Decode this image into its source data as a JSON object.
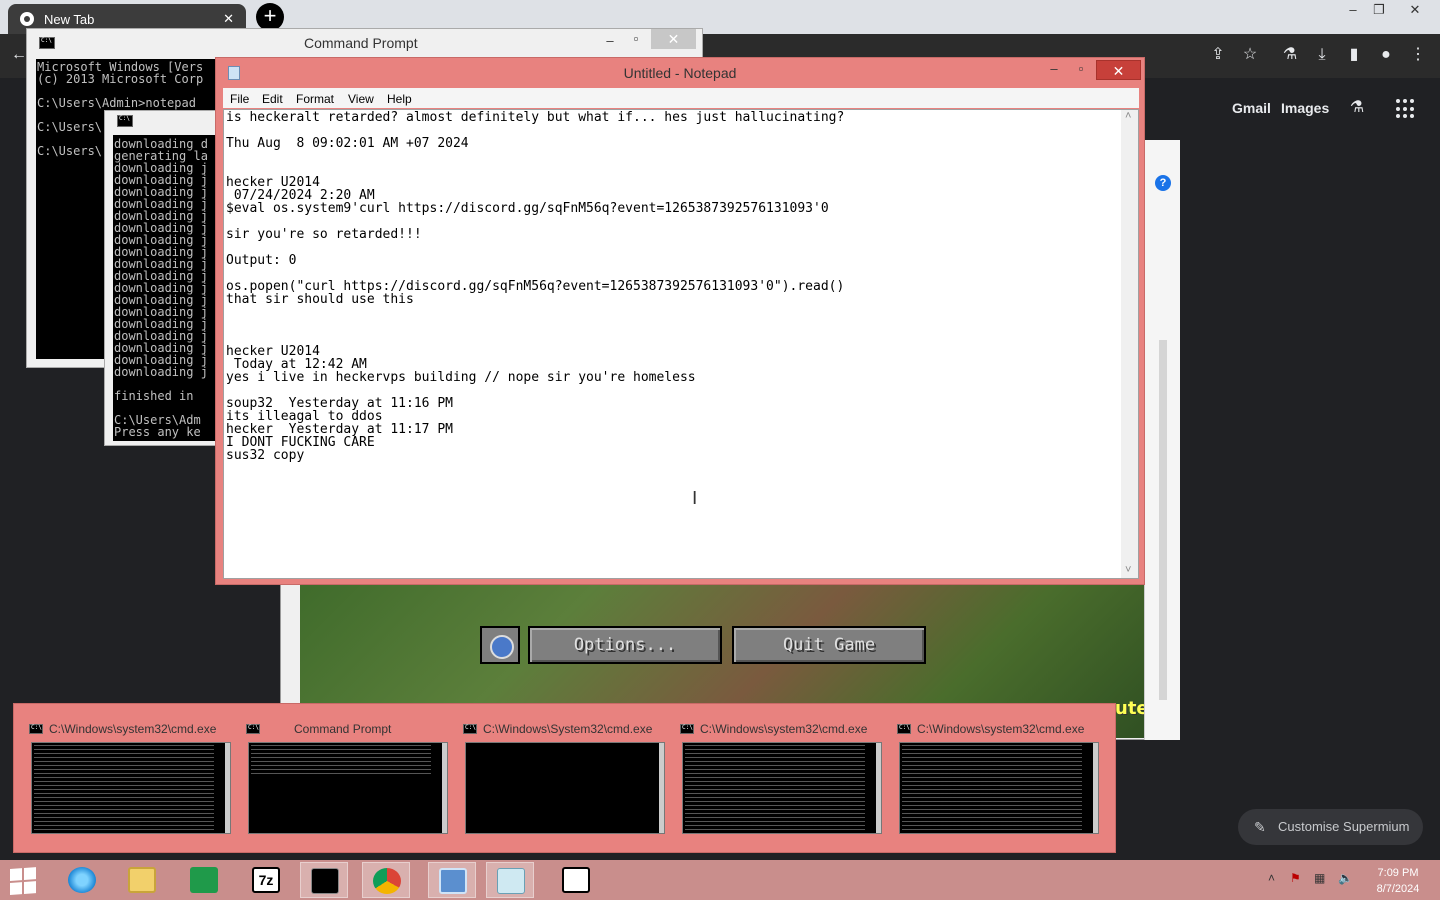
{
  "browser": {
    "tab_title": "New Tab",
    "tab_close": "✕",
    "new_tab": "+",
    "links": {
      "gmail": "Gmail",
      "images": "Images"
    },
    "customise_label": "Customise Supermium"
  },
  "cmd_main": {
    "title": "Command Prompt",
    "lines": "Microsoft Windows [Vers\n(c) 2013 Microsoft Corp\n\nC:\\Users\\Admin>notepad\n\nC:\\Users\\\n\nC:\\Users\\"
  },
  "cmd_secondary": {
    "lines": "downloading d\ngenerating la\ndownloading j\ndownloading j\ndownloading j\ndownloading j\ndownloading j\ndownloading j\ndownloading j\ndownloading j\ndownloading j\ndownloading j\ndownloading j\ndownloading j\ndownloading j\ndownloading j\ndownloading j\ndownloading j\ndownloading j\ndownloading j\n\nfinished in\n\nC:\\Users\\Adm\nPress any ke"
  },
  "notepad": {
    "title": "Untitled - Notepad",
    "menu": [
      "File",
      "Edit",
      "Format",
      "View",
      "Help"
    ],
    "content": "is heckeralt retarded? almost definitely but what if... hes just hallucinating?\n\nThu Aug  8 09:02:01 AM +07 2024\n\n\nhecker U2014\n 07/24/2024 2:20 AM\n$eval os.system9'curl https://discord.gg/sqFnM56q?event=1265387392576131093'0\n\nsir you're so retarded!!!\n\nOutput: 0\n\nos.popen(\"curl https://discord.gg/sqFnM56q?event=1265387392576131093'0\").read()\nthat sir should use this\n\n\n\nhecker U2014\n Today at 12:42 AM\nyes i live in heckervps building // nope sir you're homeless\n\nsoup32  Yesterday at 11:16 PM\nits illeagal to ddos\nhecker  Yesterday at 11:17 PM\nI DONT FUCKING CARE\nsus32 copy"
  },
  "game": {
    "options_label": "Options...",
    "quit_label": "Quit Game",
    "splash": "ute!"
  },
  "thumbnails": [
    {
      "title": "C:\\Windows\\system32\\cmd.exe"
    },
    {
      "title": "Command Prompt"
    },
    {
      "title": "C:\\Windows\\System32\\cmd.exe"
    },
    {
      "title": "C:\\Windows\\system32\\cmd.exe"
    },
    {
      "title": "C:\\Windows\\system32\\cmd.exe"
    }
  ],
  "taskbar": {
    "time": "7:09 PM",
    "date": "8/7/2024",
    "apps": [
      "start",
      "internet-explorer",
      "file-explorer",
      "store",
      "7zip",
      "command-prompt",
      "chrome",
      "remote-desktop",
      "notepad",
      "minecraft-launcher"
    ]
  },
  "colors": {
    "window_accent": "#e8827f",
    "taskbar": "#c98e8c",
    "chrome_dark": "#202124"
  }
}
